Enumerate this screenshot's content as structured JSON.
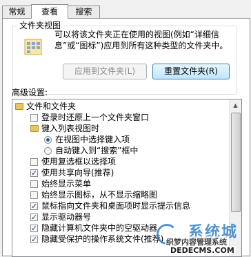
{
  "tabs": [
    {
      "label": "常规"
    },
    {
      "label": "查看"
    },
    {
      "label": "搜索"
    }
  ],
  "folder_views": {
    "title": "文件夹视图",
    "description": "可以将该文件夹正在使用的视图(例如“详细信息”或“图标”)应用到所有这种类型的文件夹中。",
    "apply_button": "应用到文件夹(L)",
    "reset_button": "重置文件夹(R)"
  },
  "advanced": {
    "label": "高级设置:",
    "items": [
      {
        "text": "文件和文件夹",
        "type": "folder"
      },
      {
        "text": "登录时还原上一个文件夹窗口",
        "type": "checkbox",
        "checked": false
      },
      {
        "text": "键入列表视图时",
        "type": "folder"
      },
      {
        "text": "在视图中选择键入项",
        "type": "radio",
        "checked": true
      },
      {
        "text": "自动键入到“搜索”框中",
        "type": "radio",
        "checked": false
      },
      {
        "text": "使用复选框以选择项",
        "type": "checkbox",
        "checked": false
      },
      {
        "text": "使用共享向导(推荐)",
        "type": "checkbox",
        "checked": true
      },
      {
        "text": "始终显示菜单",
        "type": "checkbox",
        "checked": false
      },
      {
        "text": "始终显示图标，从不显示缩略图",
        "type": "checkbox",
        "checked": false
      },
      {
        "text": "鼠标指向文件夹和桌面项时显示提示信息",
        "type": "checkbox",
        "checked": true
      },
      {
        "text": "显示驱动器号",
        "type": "checkbox",
        "checked": true
      },
      {
        "text": "隐藏计算机文件夹中的空驱动器",
        "type": "checkbox",
        "checked": true
      },
      {
        "text": "隐藏受保护的操作系统文件(推荐)",
        "type": "checkbox",
        "checked": true
      }
    ]
  },
  "watermark": {
    "brand": "系统城",
    "text": "织梦内容管理系统",
    "url": "DEDECMS.COM"
  },
  "colors": {
    "accent": "#2a7bc4",
    "folder": "#e8c55f"
  }
}
